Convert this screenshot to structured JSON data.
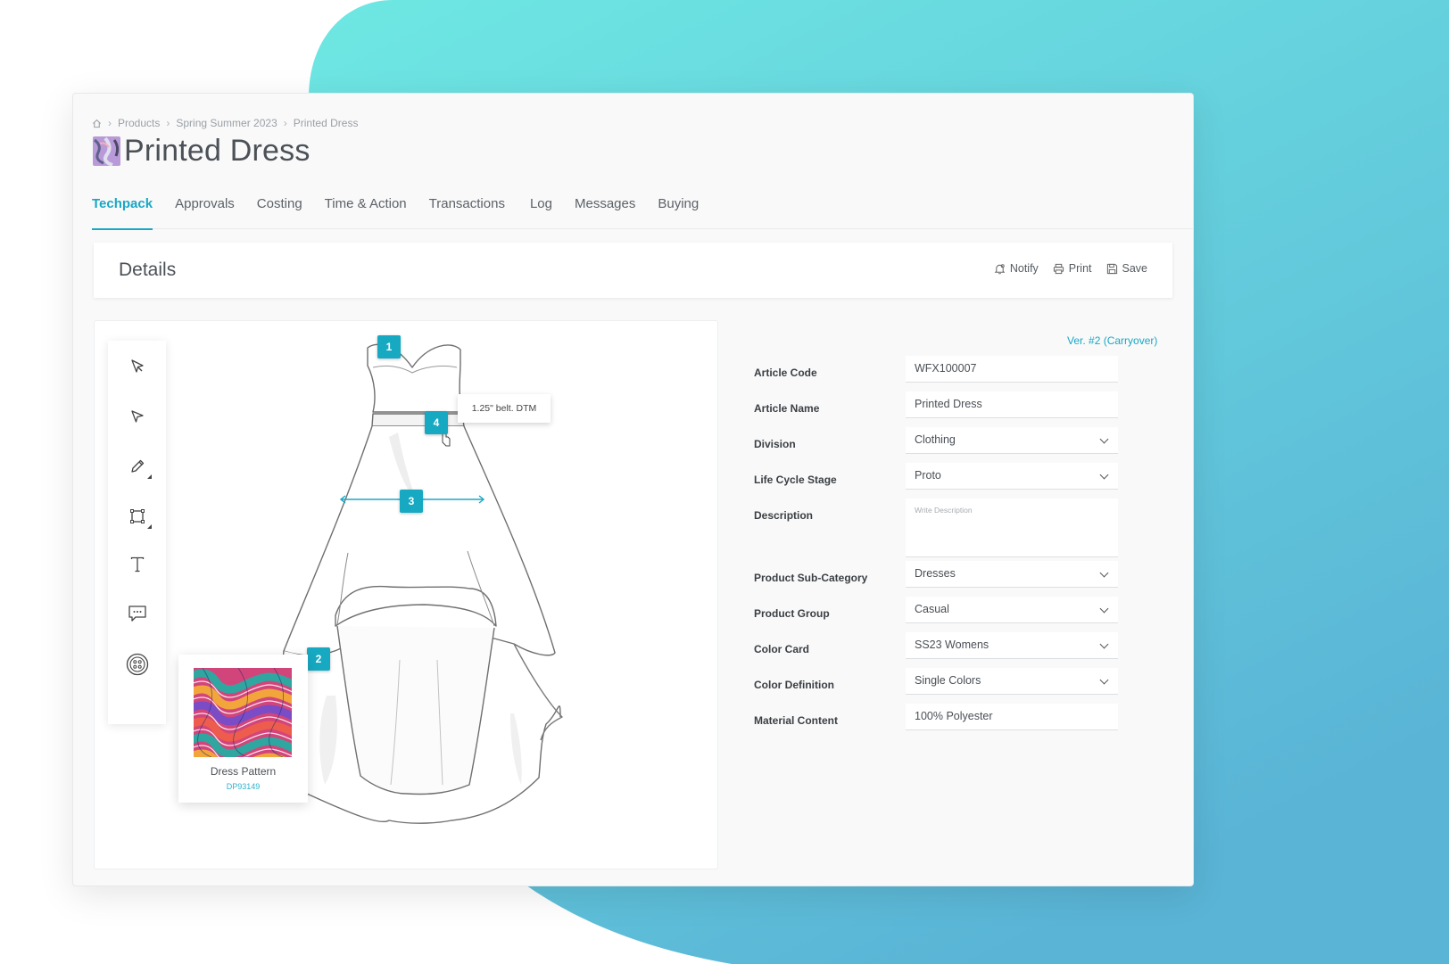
{
  "breadcrumb": {
    "items": [
      "Products",
      "Spring Summer 2023",
      "Printed Dress"
    ]
  },
  "page": {
    "title": "Printed Dress"
  },
  "tabs": [
    {
      "label": "Techpack",
      "active": true
    },
    {
      "label": "Approvals"
    },
    {
      "label": "Costing"
    },
    {
      "label": "Time & Action"
    },
    {
      "label": "Transactions"
    },
    {
      "label": "Log"
    },
    {
      "label": "Messages"
    },
    {
      "label": "Buying"
    }
  ],
  "details": {
    "title": "Details",
    "actions": {
      "notify": "Notify",
      "print": "Print",
      "save": "Save"
    }
  },
  "canvas": {
    "tools": [
      "select-arrow-icon",
      "direct-select-icon",
      "pencil-icon",
      "rectangle-icon",
      "text-icon",
      "comment-icon",
      "button-icon"
    ],
    "annotations": [
      "1",
      "2",
      "3",
      "4"
    ],
    "tooltip": "1.25\" belt. DTM",
    "swatch": {
      "name": "Dress Pattern",
      "code": "DP93149"
    }
  },
  "version": "Ver. #2 (Carryover)",
  "form": {
    "article_code": {
      "label": "Article Code",
      "value": "WFX100007"
    },
    "article_name": {
      "label": "Article Name",
      "value": "Printed Dress"
    },
    "division": {
      "label": "Division",
      "value": "Clothing"
    },
    "life_cycle_stage": {
      "label": "Life Cycle Stage",
      "value": "Proto"
    },
    "description": {
      "label": "Description",
      "value": "",
      "placeholder": "Write Description"
    },
    "product_sub_category": {
      "label": "Product Sub-Category",
      "value": "Dresses"
    },
    "product_group": {
      "label": "Product Group",
      "value": "Casual"
    },
    "color_card": {
      "label": "Color Card",
      "value": "SS23 Womens"
    },
    "color_definition": {
      "label": "Color Definition",
      "value": "Single Colors"
    },
    "material_content": {
      "label": "Material Content",
      "value": "100% Polyester"
    }
  },
  "colors": {
    "accent": "#1aa7c4",
    "badge": "#17a9c2",
    "background_gradient": [
      "#6ee6e2",
      "#5ab6d6"
    ]
  }
}
